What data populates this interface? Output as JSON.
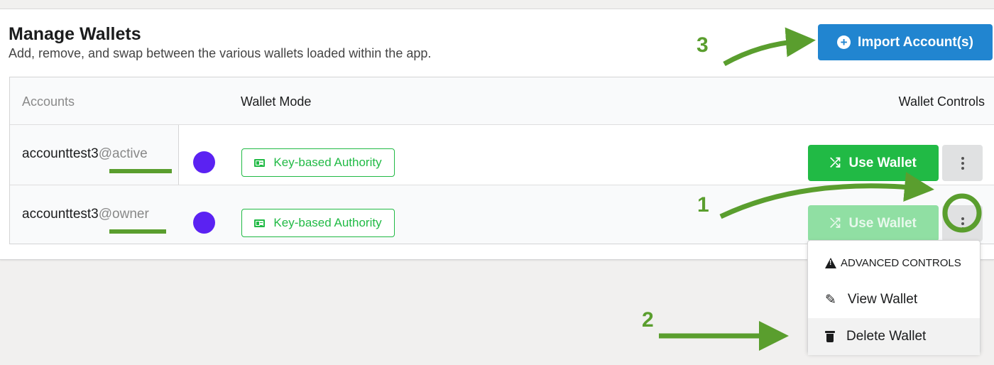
{
  "page": {
    "title": "Manage Wallets",
    "subtitle": "Add, remove, and swap between the various wallets loaded within the app.",
    "import_button": "Import Account(s)"
  },
  "table": {
    "headers": {
      "accounts": "Accounts",
      "mode": "Wallet Mode",
      "controls": "Wallet Controls"
    },
    "rows": [
      {
        "account": "accounttest3",
        "permission": "@active",
        "mode": "Key-based Authority",
        "use_label": "Use Wallet",
        "state": "enabled"
      },
      {
        "account": "accounttest3",
        "permission": "@owner",
        "mode": "Key-based Authority",
        "use_label": "Use Wallet",
        "state": "disabled"
      }
    ]
  },
  "dropdown": {
    "header": "ADVANCED CONTROLS",
    "items": [
      {
        "label": "View Wallet",
        "icon": "edit-icon"
      },
      {
        "label": "Delete Wallet",
        "icon": "trash-icon"
      }
    ]
  },
  "annotations": {
    "step1": "1",
    "step2": "2",
    "step3": "3"
  },
  "colors": {
    "primary": "#2185d0",
    "positive": "#21ba45",
    "dot": "#5b22f2",
    "annotation": "#5a9e2e"
  }
}
